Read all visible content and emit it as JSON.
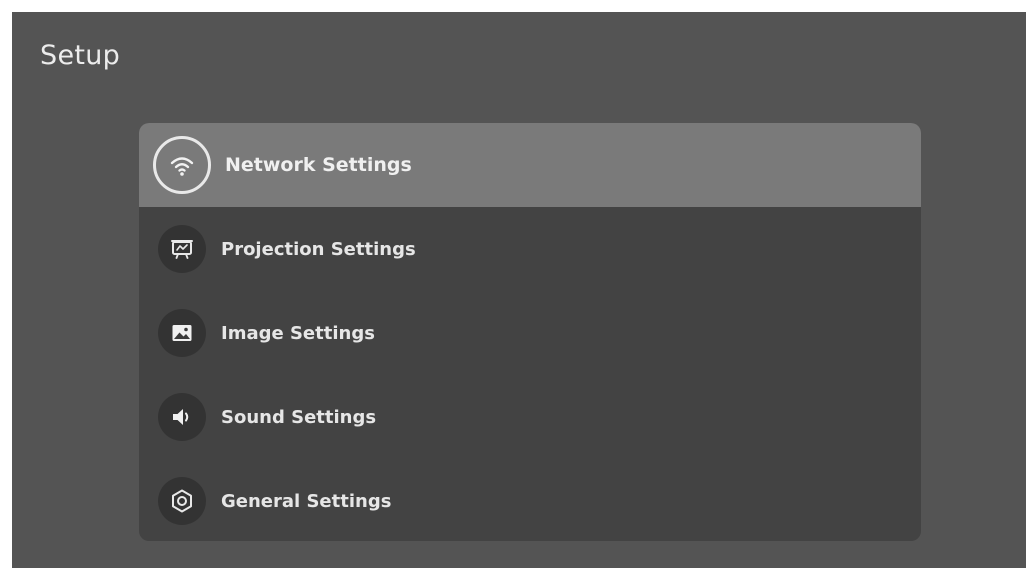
{
  "header": {
    "title": "Setup"
  },
  "menu": {
    "selected_index": 0,
    "items": [
      {
        "label": "Network Settings",
        "icon": "wifi-icon"
      },
      {
        "label": "Projection Settings",
        "icon": "projector-screen-icon"
      },
      {
        "label": "Image Settings",
        "icon": "image-icon"
      },
      {
        "label": "Sound Settings",
        "icon": "speaker-icon"
      },
      {
        "label": "General Settings",
        "icon": "gear-icon"
      }
    ]
  },
  "colors": {
    "background": "#545454",
    "panel": "#434343",
    "selected_row": "#7a7a7a",
    "text": "#e6e6e6"
  }
}
